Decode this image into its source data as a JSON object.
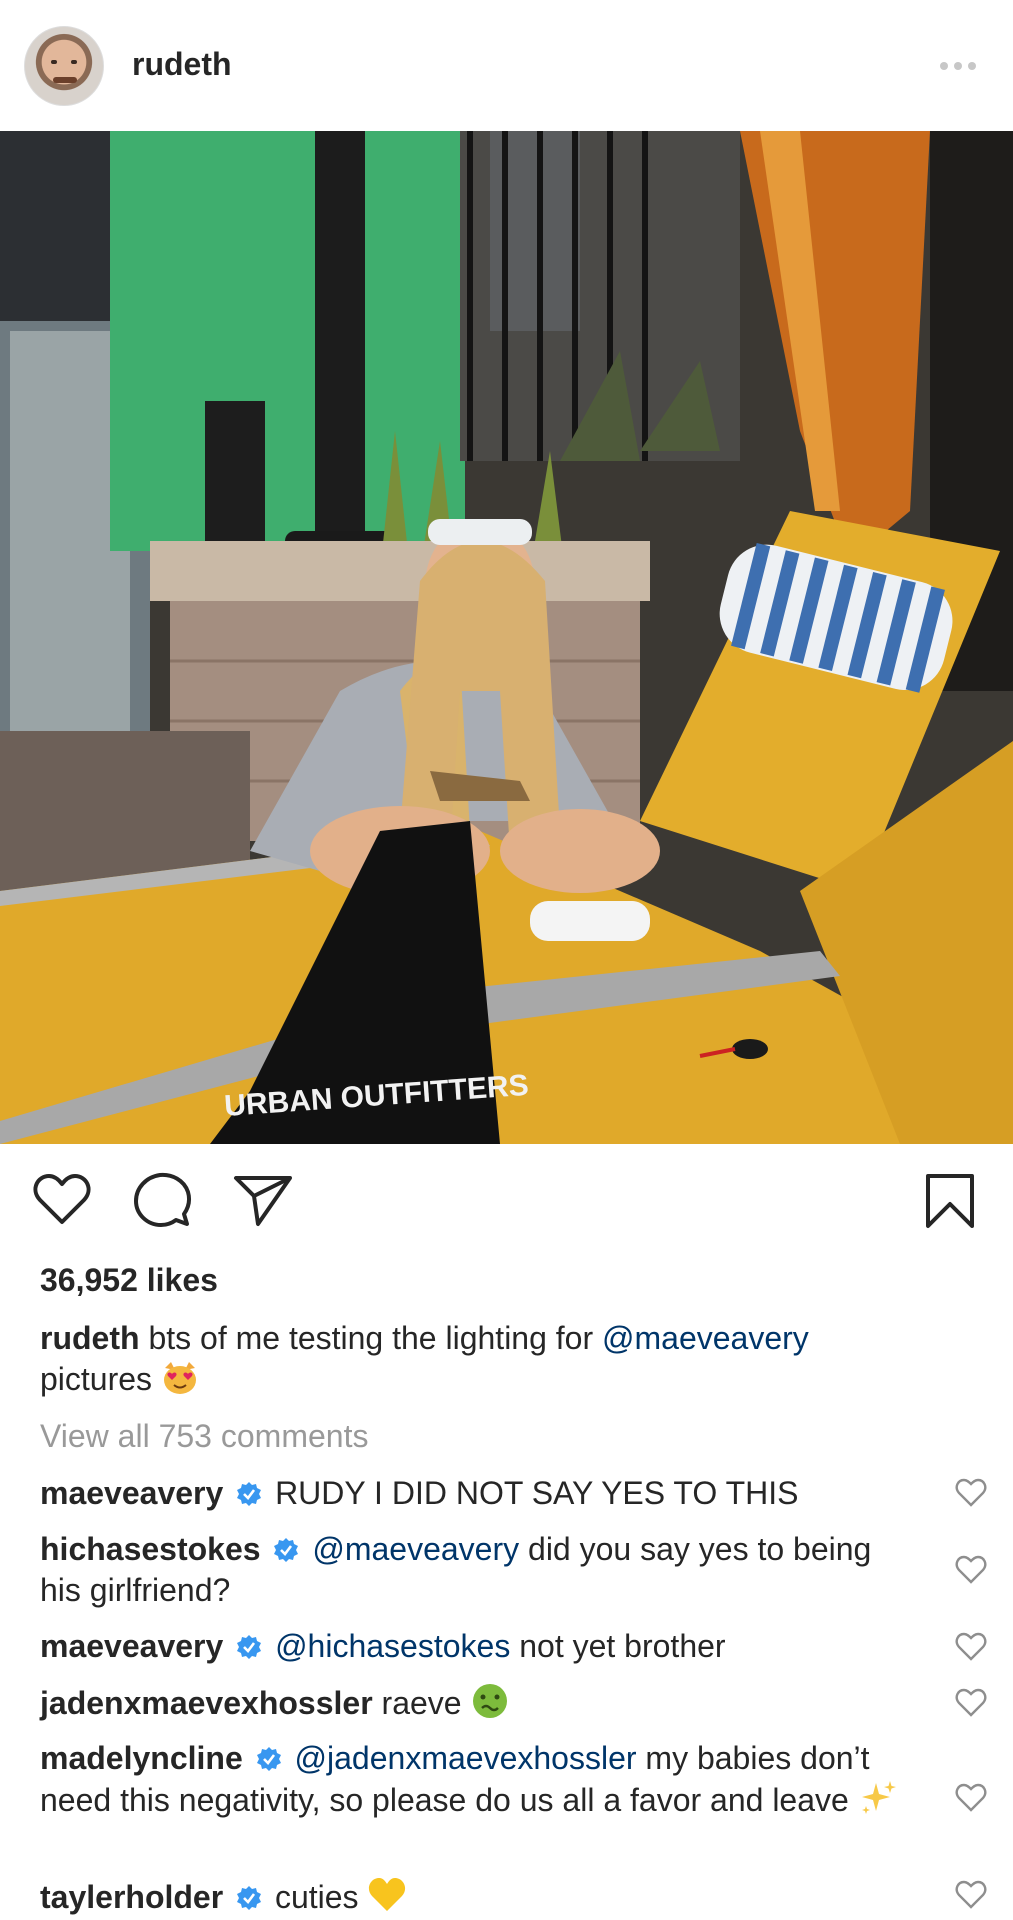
{
  "post": {
    "username": "rudeth",
    "more_icon": "more-horizontal-icon"
  },
  "photo": {
    "bag_text": "URBAN OUTFITTERS"
  },
  "actions": {
    "like_icon": "heart-icon",
    "comment_icon": "comment-icon",
    "share_icon": "send-icon",
    "save_icon": "bookmark-icon"
  },
  "likes": "36,952 likes",
  "caption": {
    "user": "rudeth",
    "text_before": "bts of me testing the lighting for",
    "mention": "@maeveavery",
    "text_after": "pictures"
  },
  "view_all": "View all 753 comments",
  "comments": [
    {
      "user": "maeveavery",
      "verified": true,
      "mention": "",
      "text": "RUDY I DID NOT SAY YES TO THIS"
    },
    {
      "user": "hichasestokes",
      "verified": true,
      "mention": "@maeveavery",
      "text": "did you say yes to being his girlfriend?"
    },
    {
      "user": "maeveavery",
      "verified": true,
      "mention": "@hichasestokes",
      "text": "not yet brother"
    },
    {
      "user": "jadenxmaevexhossler",
      "verified": false,
      "mention": "",
      "text": "raeve"
    },
    {
      "user": "madelyncline",
      "verified": true,
      "mention": "@jadenxmaevexhossler",
      "text": "my babies don’t need this negativity, so please do us all a favor and leave"
    },
    {
      "user": "taylerholder",
      "verified": true,
      "mention": "",
      "text": "cuties"
    }
  ],
  "colors": {
    "verified": "#3897f0",
    "link": "#003569",
    "muted": "#999999"
  }
}
